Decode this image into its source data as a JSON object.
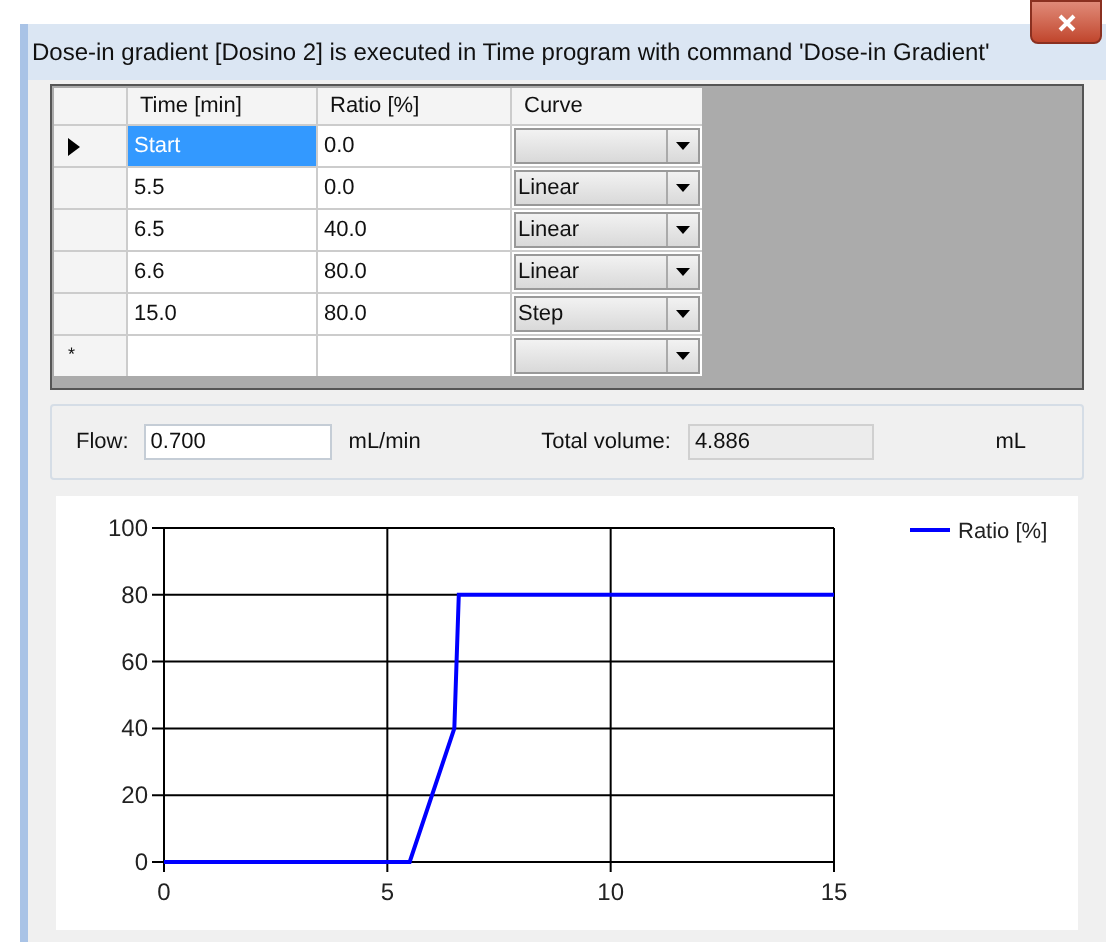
{
  "window": {
    "title": "Dose-in gradient [Dosino 2] is executed in Time program with command 'Dose-in Gradient'"
  },
  "table": {
    "columns": [
      "Time [min]",
      "Ratio [%]",
      "Curve"
    ],
    "rows": [
      {
        "selected": true,
        "time": "Start",
        "ratio": "0.0"
      },
      {
        "selected": false,
        "time": "5.5",
        "ratio": "0.0",
        "curve": "Linear"
      },
      {
        "selected": false,
        "time": "6.5",
        "ratio": "40.0",
        "curve": "Linear"
      },
      {
        "selected": false,
        "time": "6.6",
        "ratio": "80.0",
        "curve": "Linear"
      },
      {
        "selected": false,
        "time": "15.0",
        "ratio": "80.0",
        "curve": "Step"
      },
      {
        "selected": false,
        "marker": "*"
      }
    ]
  },
  "flow": {
    "label": "Flow:",
    "value": "0.700",
    "unit": "mL/min"
  },
  "total_volume": {
    "label": "Total volume:",
    "value": "4.886",
    "unit": "mL"
  },
  "chart": {
    "chart_data": {
      "type": "line",
      "x": [
        0,
        5.5,
        6.5,
        6.6,
        15
      ],
      "series": [
        {
          "name": "Ratio [%]",
          "color": "#0000ff",
          "values": [
            0,
            0,
            40,
            80,
            80
          ]
        }
      ],
      "grid": true,
      "xlim": [
        0,
        15
      ],
      "ylim": [
        0,
        100
      ],
      "xticks": [
        0,
        5,
        10,
        15
      ],
      "yticks": [
        0,
        20,
        40,
        60,
        80,
        100
      ]
    }
  }
}
